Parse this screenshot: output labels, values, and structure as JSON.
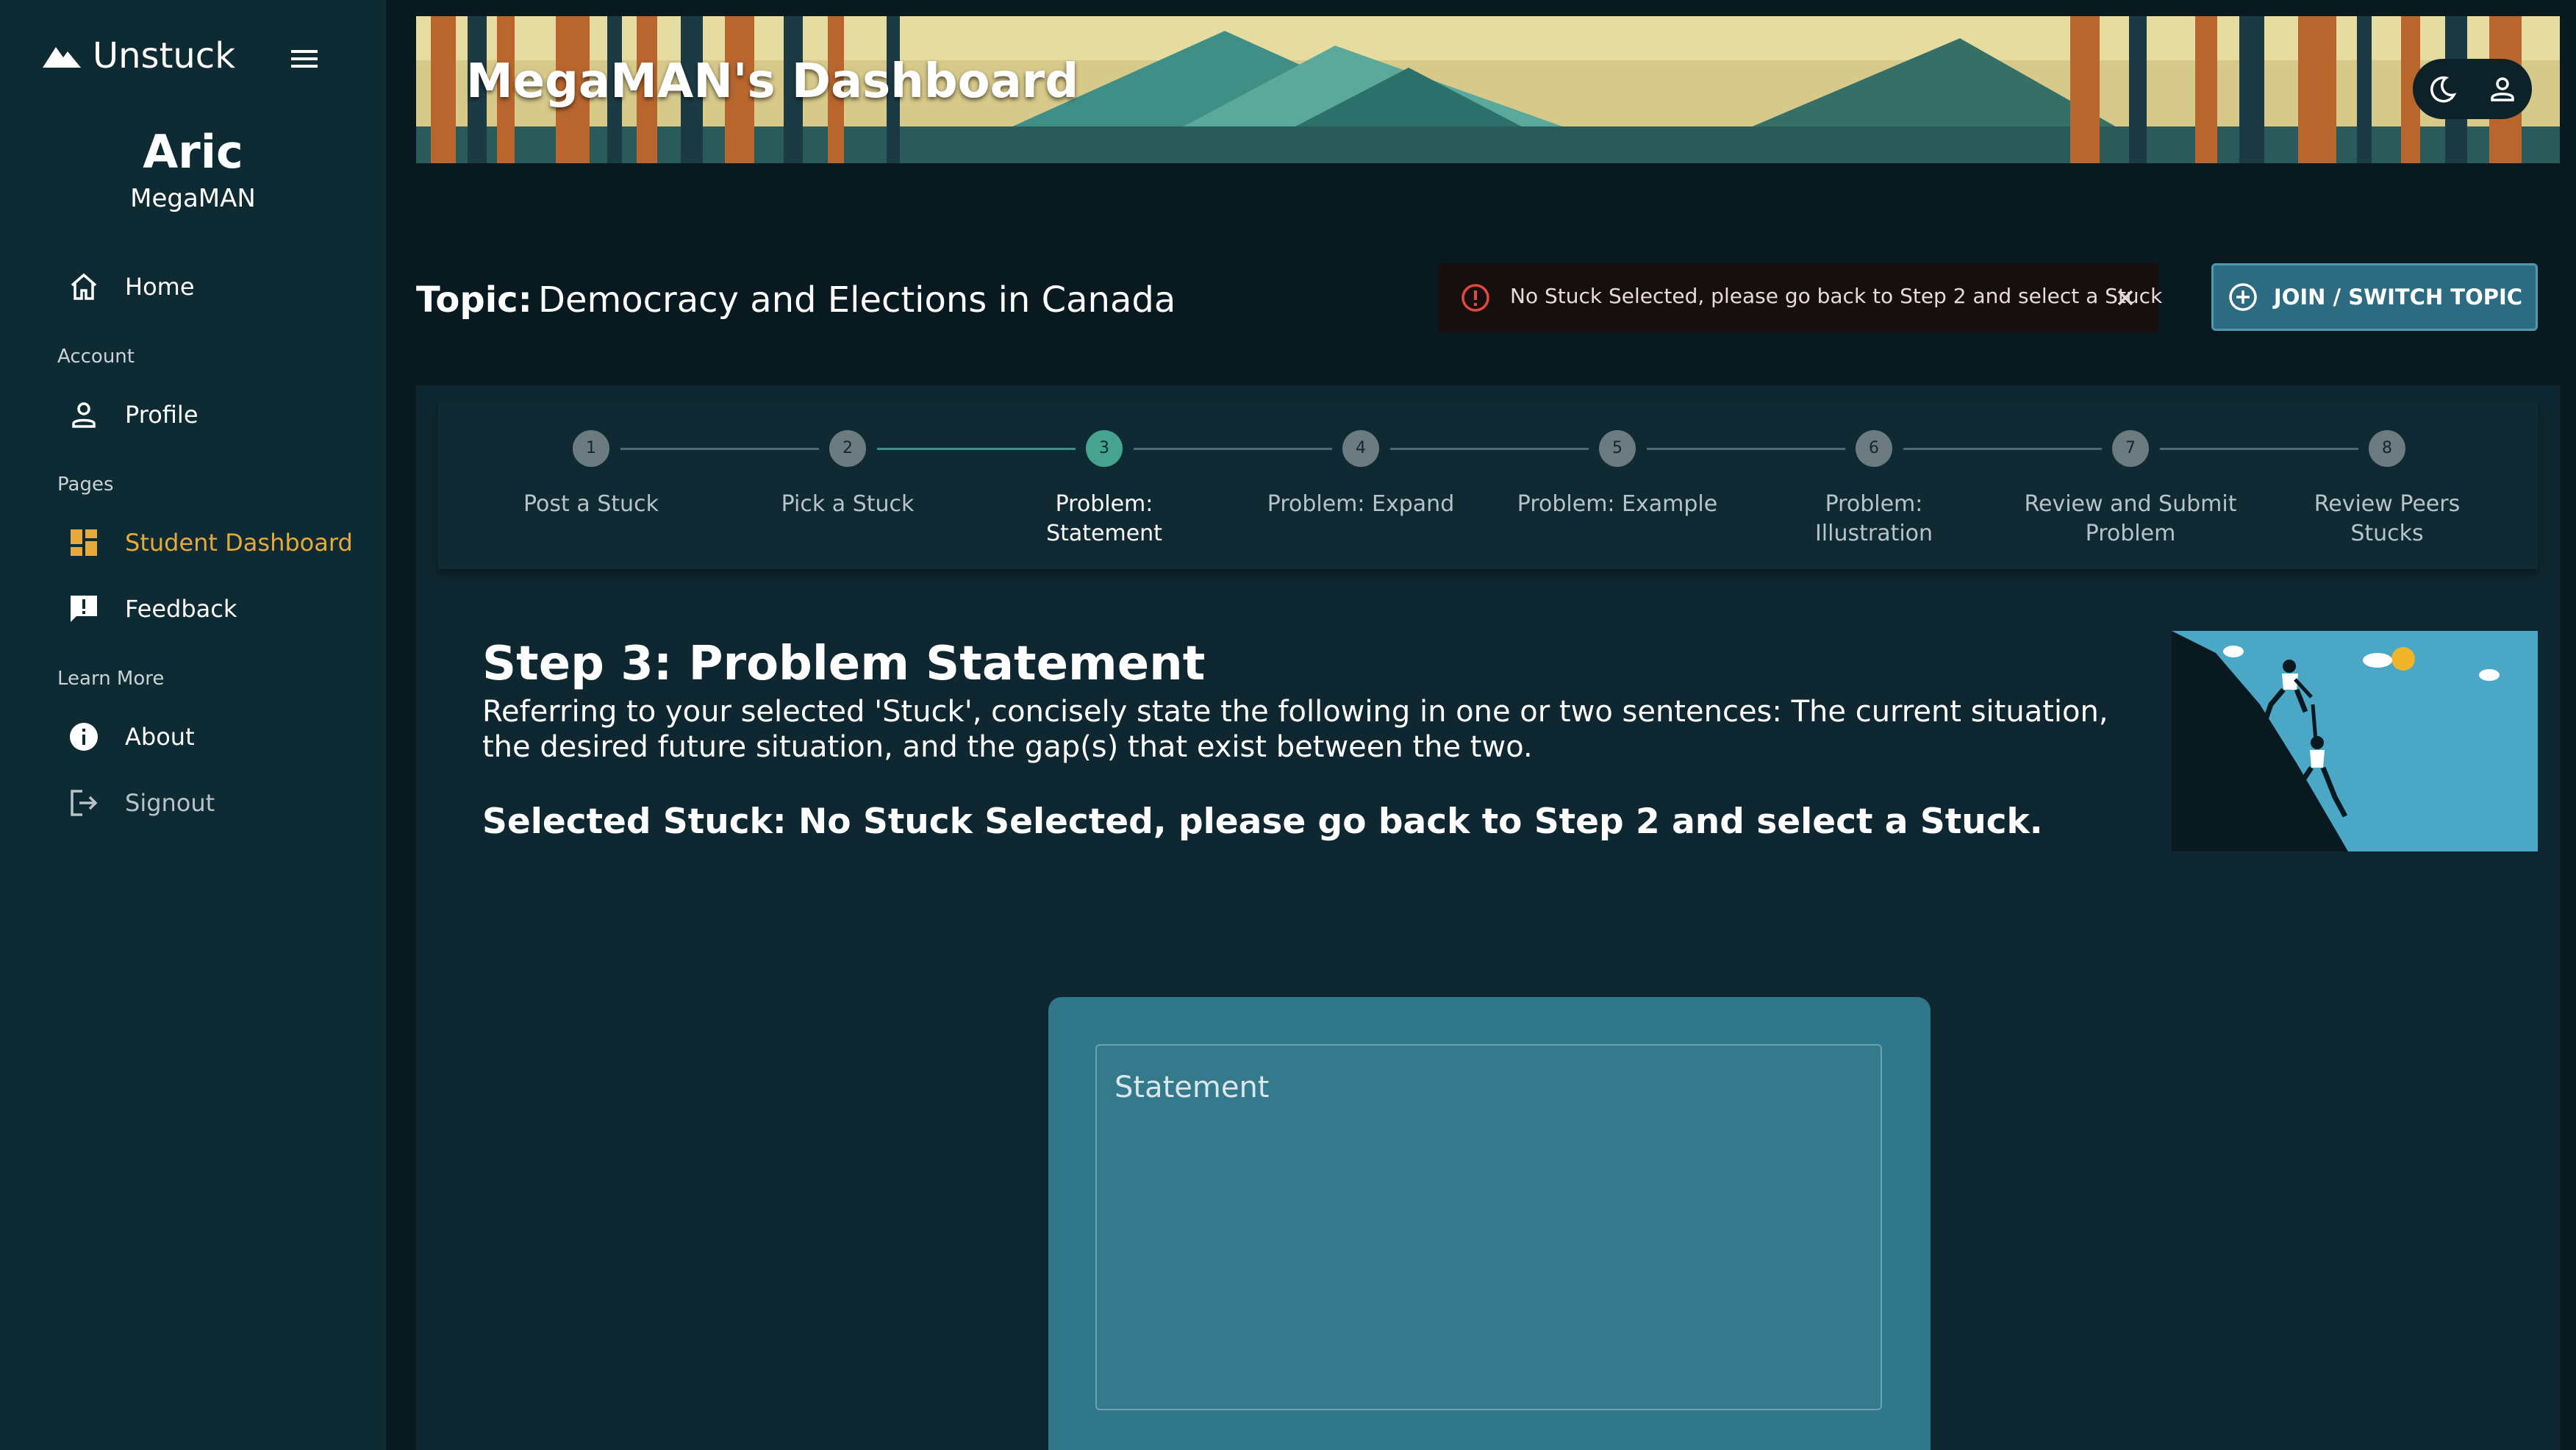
{
  "brand": {
    "name": "Unstuck",
    "icon": "mountain-icon"
  },
  "user": {
    "name": "Aric",
    "handle": "MegaMAN"
  },
  "sidebar": {
    "items": [
      {
        "label": "Home",
        "icon": "home-icon"
      },
      {
        "section": "Account"
      },
      {
        "label": "Profile",
        "icon": "person-icon"
      },
      {
        "section": "Pages"
      },
      {
        "label": "Student Dashboard",
        "icon": "dashboard-icon",
        "active": true
      },
      {
        "label": "Feedback",
        "icon": "feedback-icon"
      },
      {
        "section": "Learn More"
      },
      {
        "label": "About",
        "icon": "info-icon"
      },
      {
        "label": "Signout",
        "icon": "logout-icon"
      }
    ],
    "home": "Home",
    "account_section": "Account",
    "profile": "Profile",
    "pages_section": "Pages",
    "dashboard": "Student Dashboard",
    "feedback": "Feedback",
    "learn_more_section": "Learn More",
    "about": "About",
    "signout": "Signout"
  },
  "header": {
    "title": "MegaMAN's Dashboard"
  },
  "topic": {
    "label": "Topic:",
    "value": "Democracy and Elections in Canada"
  },
  "alert": {
    "message": "No Stuck Selected, please go back to Step 2 and select a Stuck",
    "color": "#e0493c"
  },
  "join_button": {
    "label": "JOIN / SWITCH TOPIC"
  },
  "stepper": {
    "active_step": 3,
    "steps": [
      {
        "number": "1",
        "label": "Post a Stuck"
      },
      {
        "number": "2",
        "label": "Pick a Stuck"
      },
      {
        "number": "3",
        "label": "Problem: Statement"
      },
      {
        "number": "4",
        "label": "Problem: Expand"
      },
      {
        "number": "5",
        "label": "Problem: Example"
      },
      {
        "number": "6",
        "label": "Problem: Illustration"
      },
      {
        "number": "7",
        "label": "Review and Submit Problem"
      },
      {
        "number": "8",
        "label": "Review Peers Stucks"
      }
    ]
  },
  "step": {
    "title": "Step 3: Problem Statement",
    "description": "Referring to your selected 'Stuck', concisely state the following in one or two sentences: The current situation, the desired future situation, and the gap(s) that exist between the two.",
    "selected_stuck": "Selected Stuck: No Stuck Selected, please go back to Step 2 and select a Stuck."
  },
  "statement_field": {
    "label": "Statement",
    "value": ""
  },
  "colors": {
    "accent": "#e8a93b",
    "sidebar": "#0e2a33",
    "card": "#30778b",
    "active_step": "#46a38f"
  }
}
